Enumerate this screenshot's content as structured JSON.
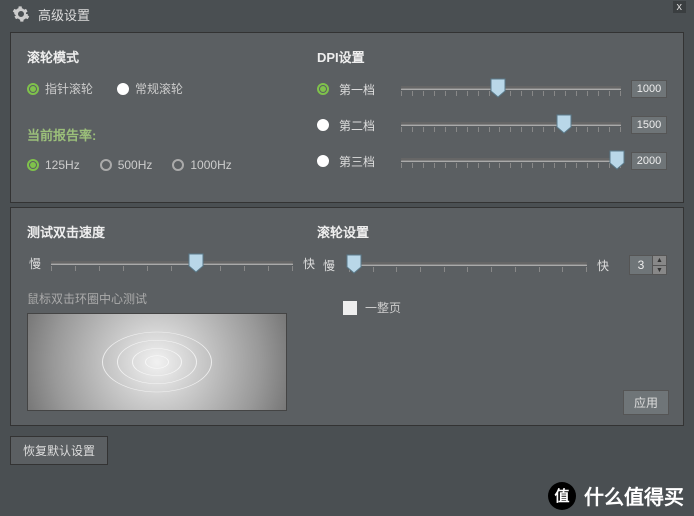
{
  "header": {
    "title": "高级设置",
    "close": "x"
  },
  "panel1": {
    "wheel": {
      "title": "滚轮模式",
      "opt1": "指针滚轮",
      "opt2": "常规滚轮",
      "selected": 0
    },
    "report": {
      "title": "当前报告率:",
      "opt1": "125Hz",
      "opt2": "500Hz",
      "opt3": "1000Hz",
      "selected": 0
    },
    "dpi": {
      "title": "DPI设置",
      "rows": [
        {
          "label": "第一档",
          "value": 1000,
          "pos": 44
        },
        {
          "label": "第二档",
          "value": 1500,
          "pos": 74
        },
        {
          "label": "第三档",
          "value": 2000,
          "pos": 98
        }
      ]
    }
  },
  "panel2": {
    "dclick": {
      "title": "测试双击速度",
      "slow": "慢",
      "fast": "快",
      "pos": 60,
      "help": "鼠标双击环圈中心测试"
    },
    "wheelset": {
      "title": "滚轮设置",
      "slow": "慢",
      "fast": "快",
      "pos": 2,
      "lines": "3",
      "page": "一整页",
      "apply": "应用"
    }
  },
  "footer": {
    "restore": "恢复默认设置"
  },
  "watermark": {
    "badge": "值",
    "text": "什么值得买"
  }
}
